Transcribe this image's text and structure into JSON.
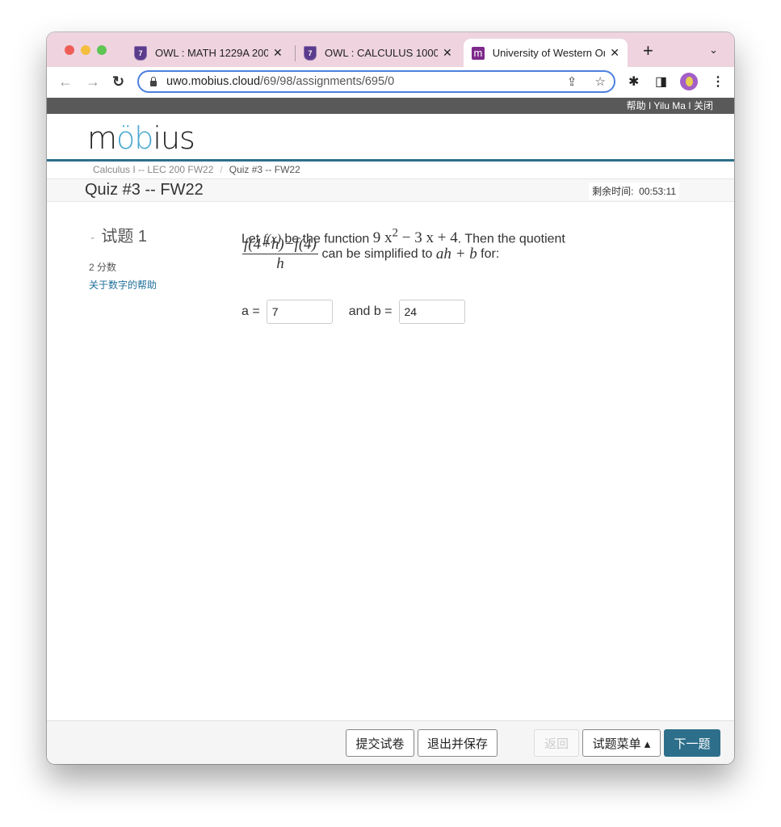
{
  "browser": {
    "tabs": [
      {
        "title": "OWL : MATH 1229A 200",
        "icon": "owl-shield-icon",
        "active": false
      },
      {
        "title": "OWL : CALCULUS 1000/",
        "icon": "owl-shield-icon",
        "active": false
      },
      {
        "title": "University of Western Or",
        "icon": "mobius-m-icon",
        "active": true
      }
    ],
    "close_glyph": "✕",
    "new_tab_glyph": "+",
    "tab_menu_glyph": "⌄",
    "url_host": "uwo.mobius.cloud",
    "url_path": "/69/98/assignments/695/0"
  },
  "topbar": {
    "help": "帮助",
    "user": "Yilu Ma",
    "close": "关闭",
    "separator": " I "
  },
  "logo": {
    "pre": "m",
    "o": "ö",
    "b": "b",
    "post": "ius"
  },
  "breadcrumb": {
    "course": "Calculus I -- LEC 200 FW22",
    "separator": "/",
    "current": "Quiz #3 -- FW22"
  },
  "page": {
    "title": "Quiz #3 -- FW22",
    "timer_label": "剩余时间:",
    "timer_value": "00:53:11"
  },
  "question": {
    "label": "试题 1",
    "collapse_glyph": "-",
    "points": "2 分数",
    "help_link": "关于数字的帮助",
    "text_let": "Let",
    "fx": "f(x)",
    "text_be": "be the function",
    "function_expr_a": "9 x",
    "function_exp": "2",
    "function_expr_b": " − 3 x + 4",
    "text_then": ". Then the quotient",
    "frac_num": "f(4+h)−f(4)",
    "frac_den": "h",
    "text_simplified": "can be simplified to",
    "target_expr": "ah + b",
    "text_for": "for:",
    "a_label": "a =",
    "a_value": "7",
    "b_label": "and b =",
    "b_value": "24"
  },
  "footer": {
    "submit": "提交试卷",
    "exit_save": "退出并保存",
    "back": "返回",
    "question_menu": "试题菜单 ▴",
    "next": "下一题"
  }
}
